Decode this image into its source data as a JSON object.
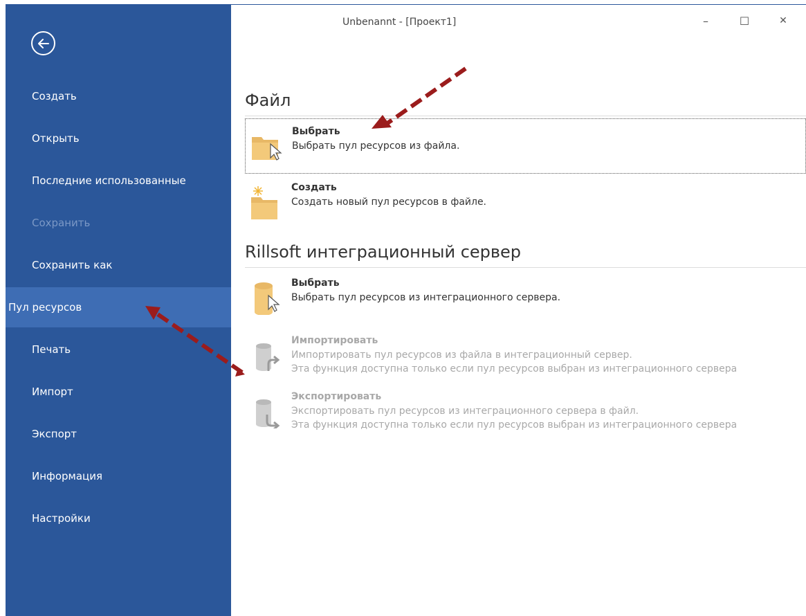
{
  "window": {
    "title": "Unbenannt - [Проект1]",
    "minimize_glyph": "–",
    "maximize_glyph": "☐",
    "close_glyph": "✕"
  },
  "sidebar": {
    "items": [
      {
        "label": "Создать",
        "state": "normal"
      },
      {
        "label": "Открыть",
        "state": "normal"
      },
      {
        "label": "Последние использованные",
        "state": "normal"
      },
      {
        "label": "Сохранить",
        "state": "disabled"
      },
      {
        "label": "Сохранить как",
        "state": "normal"
      },
      {
        "label": "Пул ресурсов",
        "state": "active"
      },
      {
        "label": "Печать",
        "state": "normal"
      },
      {
        "label": "Импорт",
        "state": "normal"
      },
      {
        "label": "Экспорт",
        "state": "normal"
      },
      {
        "label": "Информация",
        "state": "normal"
      },
      {
        "label": "Настройки",
        "state": "normal"
      }
    ]
  },
  "sections": {
    "file": {
      "title": "Файл",
      "items": [
        {
          "title": "Выбрать",
          "desc": "Выбрать пул ресурсов из файла.",
          "icon": "folder-cursor-icon"
        },
        {
          "title": "Создать",
          "desc": "Создать новый пул ресурсов в файле.",
          "icon": "new-folder-icon"
        }
      ]
    },
    "server": {
      "title": "Rillsoft интеграционный сервер",
      "items": [
        {
          "title": "Выбрать",
          "desc": "Выбрать пул ресурсов из интеграционного сервера.",
          "icon": "database-cursor-icon"
        },
        {
          "title": "Импортировать",
          "desc": "Импортировать пул ресурсов из файла в интеграционный сервер.",
          "desc2": "Эта функция доступна только если пул ресурсов выбран из интеграционного сервера",
          "icon": "database-import-icon"
        },
        {
          "title": "Экспортировать",
          "desc": "Экспортировать пул ресурсов из интеграционного сервера в файл.",
          "desc2": "Эта функция доступна только если пул ресурсов выбран из интеграционного сервера",
          "icon": "database-export-icon"
        }
      ]
    }
  },
  "colors": {
    "sidebar": "#2b579a",
    "sidebar_active": "#3e6db4",
    "annotation_arrow": "#9b1c1c",
    "folder": "#e8b866"
  }
}
